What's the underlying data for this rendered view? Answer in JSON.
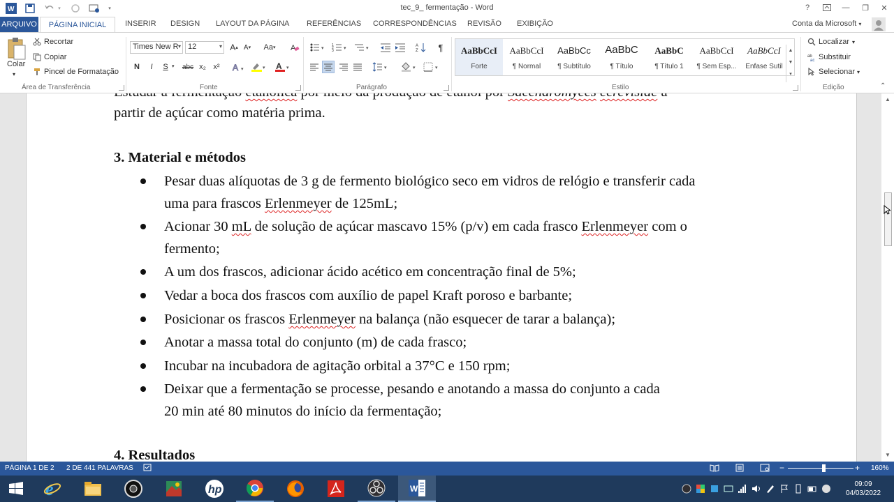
{
  "window": {
    "title": "tec_9_ fermentação - Word",
    "help_label": "?",
    "min_label": "—",
    "max_label": "❐",
    "close_label": "✕"
  },
  "tabs": {
    "file": "ARQUIVO",
    "home": "PÁGINA INICIAL",
    "items": [
      "INSERIR",
      "DESIGN",
      "LAYOUT DA PÁGINA",
      "REFERÊNCIAS",
      "CORRESPONDÊNCIAS",
      "REVISÃO",
      "EXIBIÇÃO"
    ],
    "account": "Conta da Microsoft"
  },
  "ribbon": {
    "clipboard": {
      "paste": "Colar",
      "cut": "Recortar",
      "copy": "Copiar",
      "format_painter": "Pincel de Formatação",
      "label": "Área de Transferência"
    },
    "font": {
      "name": "Times New R",
      "size": "12",
      "label": "Fonte",
      "bold": "N",
      "italic": "I",
      "underline": "S",
      "strike": "abc",
      "subscript": "x₂",
      "superscript": "x²",
      "grow": "A",
      "shrink": "A",
      "case": "Aa"
    },
    "paragraph": {
      "label": "Parágrafo"
    },
    "styles": {
      "label": "Estilo",
      "items": [
        {
          "sample": "AaBbCcI",
          "name": "Forte"
        },
        {
          "sample": "AaBbCcI",
          "name": "¶ Normal"
        },
        {
          "sample": "AaBbCc",
          "name": "¶ Subtítulo"
        },
        {
          "sample": "AaBbC",
          "name": "¶ Título"
        },
        {
          "sample": "AaBbC",
          "name": "¶ Título 1"
        },
        {
          "sample": "AaBbCcI",
          "name": "¶ Sem Esp..."
        },
        {
          "sample": "AaBbCcI",
          "name": "Ênfase Sutil"
        }
      ]
    },
    "editing": {
      "find": "Localizar",
      "replace": "Substituir",
      "select": "Selecionar",
      "label": "Edição"
    }
  },
  "document": {
    "top_line": "Estudar a fermentação etanólica por meio da produção de etanol por Saccharomyces cerevisiae a",
    "line2": "partir de açúcar como matéria prima.",
    "section3": "3. Material e métodos",
    "bullets": [
      [
        "Pesar duas alíquotas de 3 g de fermento biológico seco em vidros de relógio e transferir cada",
        "uma para frascos Erlenmeyer de 125mL;"
      ],
      [
        "Acionar 30 mL de solução de açúcar mascavo 15% (p/v) em cada frasco Erlenmeyer com o",
        "fermento;"
      ],
      [
        "A um dos frascos, adicionar ácido acético em concentração final de 5%;"
      ],
      [
        "Vedar a boca dos frascos com auxílio de papel Kraft poroso e barbante;"
      ],
      [
        "Posicionar os frascos Erlenmeyer na balança (não esquecer de tarar a balança);"
      ],
      [
        "Anotar a massa total do conjunto (m) de cada frasco;"
      ],
      [
        "Incubar na incubadora de agitação orbital a 37°C e 150 rpm;"
      ],
      [
        "Deixar que a fermentação se processe, pesando e anotando a massa do conjunto a cada",
        "20 min até 80 minutos do início da fermentação;"
      ]
    ],
    "section4": "4. Resultados",
    "scroll_position": 0.43
  },
  "status": {
    "page": "PÁGINA 1 DE 2",
    "words": "2 DE 441 PALAVRAS",
    "zoom": "160%",
    "zoom_level": 1.6
  },
  "taskbar": {
    "apps": [
      "start-icon",
      "internet-explorer-icon",
      "file-explorer-icon",
      "camera-icon",
      "photos-icon",
      "hp-icon",
      "chrome-icon",
      "firefox-icon",
      "acrobat-icon",
      "obs-icon",
      "word-icon"
    ],
    "time": "09:09",
    "date": "04/03/2022"
  },
  "colors": {
    "accent": "#2b579a",
    "taskbar": "#1f3a5c",
    "spell_error": "#dd2222"
  }
}
